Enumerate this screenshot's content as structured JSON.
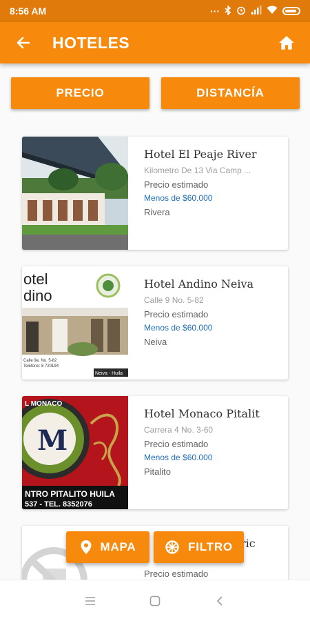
{
  "status": {
    "time": "8:56 AM"
  },
  "appbar": {
    "title": "HOTELES"
  },
  "sort": {
    "price_label": "PRECIO",
    "distance_label": "DISTANCÍA"
  },
  "hotels": [
    {
      "name": "Hotel El Peaje River",
      "address": "Kilometro De 13 Via Camp ...",
      "price_label": "Precio estimado",
      "price_value": "Menos de $60.000",
      "city": "Rivera"
    },
    {
      "name": "Hotel Andino Neiva",
      "address": "Calle 9 No. 5-82",
      "price_label": "Precio estimado",
      "price_value": "Menos de $60.000",
      "city": "Neiva",
      "image_text": {
        "line1": "otel",
        "line2": "dino",
        "caption1": "Calle 9a. No. 5-82",
        "caption2": "Teléfono: 8 720194",
        "sign": "Neiva - Huila"
      }
    },
    {
      "name": "Hotel Monaco Pitalit",
      "address": "Carrera 4 No. 3-60",
      "price_label": "Precio estimado",
      "price_value": "Menos de $60.000",
      "city": "Pitalito",
      "image_text": {
        "logo_line": "L MONACO",
        "banner1": "NTRO PITALITO HUILA",
        "banner2": "537 - TEL. 8352076"
      }
    },
    {
      "name": "ric",
      "price_label": "Precio estimado"
    }
  ],
  "fab": {
    "map_label": "MAPA",
    "filter_label": "FILTRO"
  },
  "colors": {
    "primary": "#F78A0C",
    "status_bar": "#E07A0A",
    "price": "#1f6fb7"
  }
}
